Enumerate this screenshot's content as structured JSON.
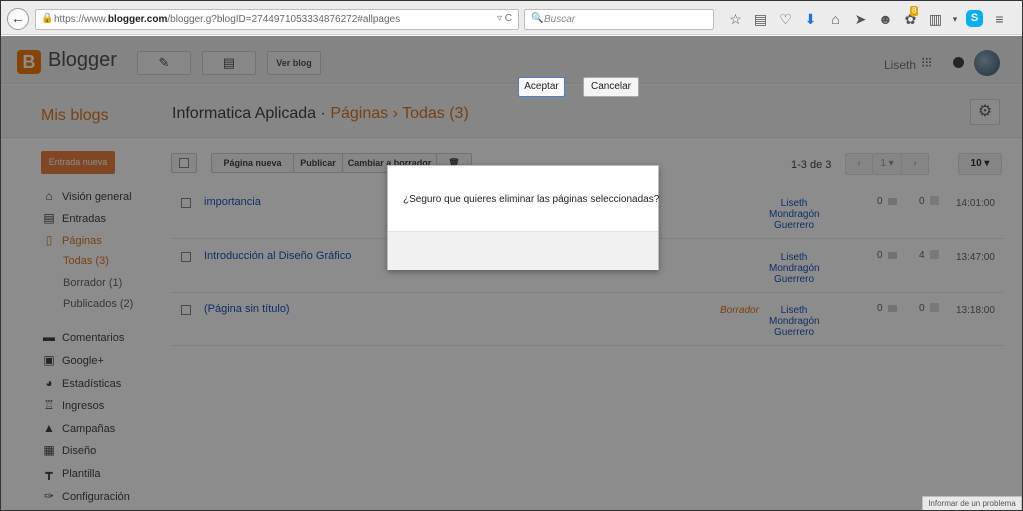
{
  "browser": {
    "url_prefix": "https://www.",
    "url_domain": "blogger.com",
    "url_rest": "/blogger.g?blogID=2744971053334876272#allpages",
    "url_controls": "▿ C",
    "search_placeholder": "Buscar",
    "notification_count": "8"
  },
  "header": {
    "app_name": "Blogger",
    "view_blog_label": "Ver blog",
    "user_name": "Liseth"
  },
  "title_band": {
    "my_blogs": "Mis blogs",
    "blog_name": "Informatica Aplicada",
    "separator": "·",
    "section": "Páginas",
    "arrow": "›",
    "filter": "Todas (3)"
  },
  "sidebar": {
    "new_entry": "Entrada nueva",
    "items": [
      {
        "label": "Visión general",
        "icon": "home-icon"
      },
      {
        "label": "Entradas",
        "icon": "document-icon"
      },
      {
        "label": "Páginas",
        "icon": "page-icon"
      },
      {
        "label": "Comentarios",
        "icon": "comment-icon"
      },
      {
        "label": "Google+",
        "icon": "google-plus-icon"
      },
      {
        "label": "Estadísticas",
        "icon": "pie-chart-icon"
      },
      {
        "label": "Ingresos",
        "icon": "trophy-icon"
      },
      {
        "label": "Campañas",
        "icon": "campaign-icon"
      },
      {
        "label": "Diseño",
        "icon": "layout-icon"
      },
      {
        "label": "Plantilla",
        "icon": "template-icon"
      },
      {
        "label": "Configuración",
        "icon": "wrench-icon"
      }
    ],
    "pages_sub": [
      {
        "label": "Todas (3)"
      },
      {
        "label": "Borrador (1)"
      },
      {
        "label": "Publicados (2)"
      }
    ]
  },
  "toolbar": {
    "new_page": "Página nueva",
    "publish": "Publicar",
    "revert": "Cambiar a borrador",
    "range": "1-3 de 3",
    "page": "1",
    "per_page": "10"
  },
  "rows": [
    {
      "title": "importancia",
      "draft": "",
      "author": [
        "Liseth",
        "Mondragón",
        "Guerrero"
      ],
      "comments": "0",
      "views": "0",
      "time": "14:01:00"
    },
    {
      "title": "Introducción al Diseño Gráfico",
      "draft": "",
      "author": [
        "Liseth",
        "Mondragón",
        "Guerrero"
      ],
      "comments": "0",
      "views": "4",
      "time": "13:47:00"
    },
    {
      "title": "(Página sin título)",
      "draft": "Borrador",
      "author": [
        "Liseth",
        "Mondragón",
        "Guerrero"
      ],
      "comments": "0",
      "views": "0",
      "time": "13:18:00"
    }
  ],
  "dialog": {
    "message": "¿Seguro que quieres eliminar las páginas seleccionadas?",
    "accept": "Aceptar",
    "cancel": "Cancelar"
  },
  "footer": {
    "report": "Informar de un problema"
  }
}
